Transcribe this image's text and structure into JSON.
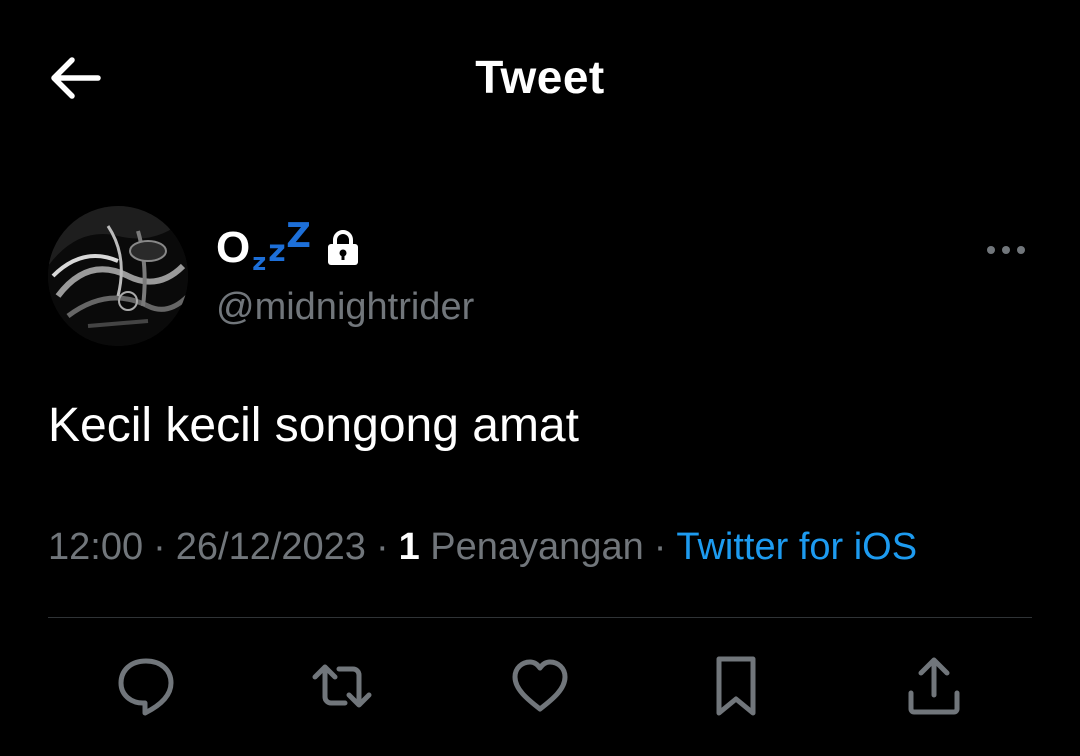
{
  "header": {
    "title": "Tweet"
  },
  "author": {
    "display_name": "O",
    "sleep_emoji": [
      "z",
      "z",
      "Z"
    ],
    "handle": "@midnightrider",
    "protected": true
  },
  "tweet": {
    "text": "Kecil kecil songong amat"
  },
  "meta": {
    "time": "12:00",
    "date": "26/12/2023",
    "views_count": "1",
    "views_label": "Penayangan",
    "source": "Twitter for iOS",
    "separator": "·"
  },
  "icons": {
    "back": "arrow-left-icon",
    "lock": "lock-icon",
    "more": "more-horizontal-icon",
    "reply": "reply-icon",
    "retweet": "retweet-icon",
    "like": "heart-icon",
    "bookmark": "bookmark-icon",
    "share": "share-icon"
  },
  "colors": {
    "background": "#000000",
    "text_primary": "#ffffff",
    "text_secondary": "#71767b",
    "accent": "#1d9bf0",
    "divider": "#2f3336",
    "zzz": "#1d6fd8"
  }
}
